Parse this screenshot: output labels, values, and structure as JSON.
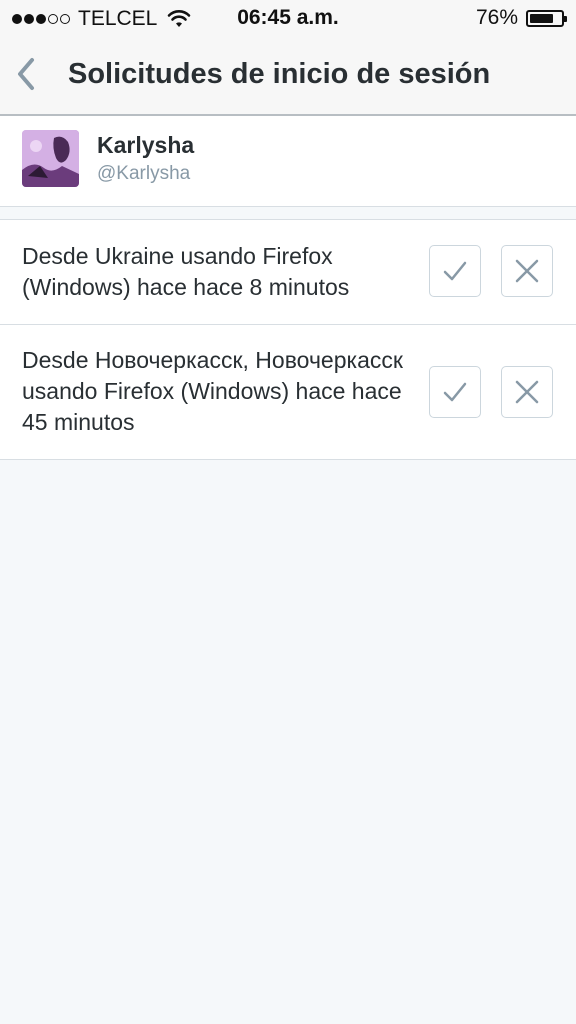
{
  "status_bar": {
    "carrier": "TELCEL",
    "time": "06:45 a.m.",
    "battery_percent": "76%",
    "battery_level": 0.76,
    "signal_bars_filled": 3,
    "signal_bars_total": 5
  },
  "nav": {
    "title": "Solicitudes de inicio de sesión",
    "back_icon": "chevron-left-icon"
  },
  "account": {
    "name": "Karlysha",
    "handle": "@Karlysha"
  },
  "requests": [
    {
      "text": "Desde Ukraine usando Firefox (Windows) hace hace 8 minutos",
      "approve_icon": "checkmark-icon",
      "deny_icon": "close-icon"
    },
    {
      "text": "Desde Новочеркасск, Новочеркасск usando Firefox (Windows) hace hace 45 minutos",
      "approve_icon": "checkmark-icon",
      "deny_icon": "close-icon"
    }
  ],
  "colors": {
    "background": "#f5f8fa",
    "text": "#292f33",
    "secondary_text": "#8899a6",
    "icon": "#8899a6"
  }
}
